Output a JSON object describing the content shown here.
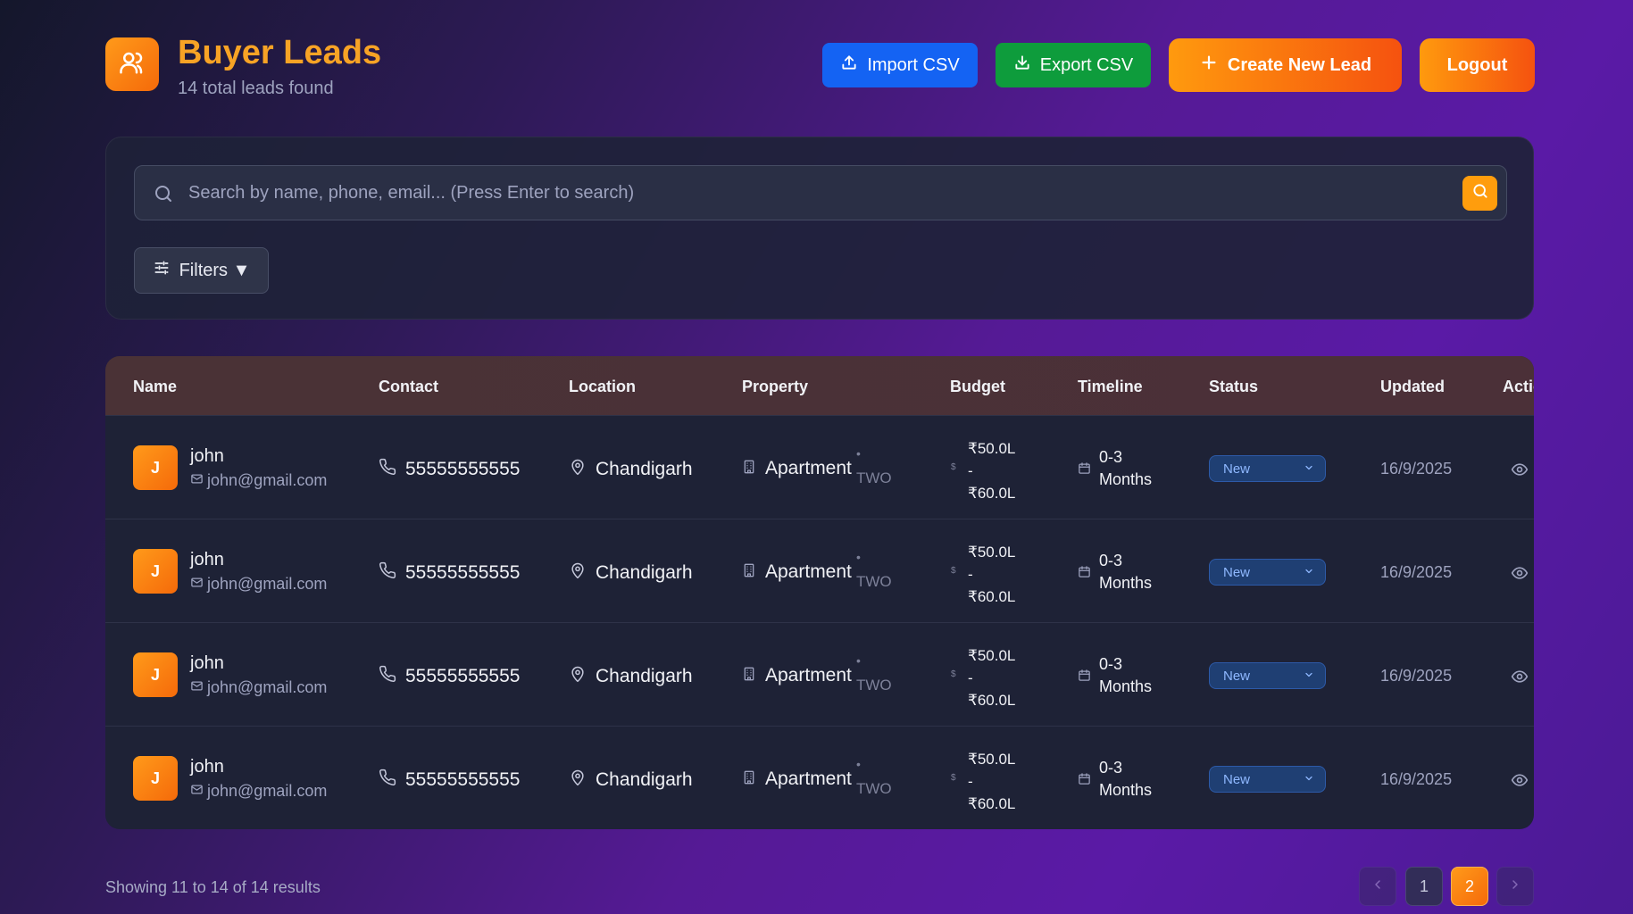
{
  "header": {
    "title": "Buyer Leads",
    "subtitle": "14 total leads found",
    "import_label": "Import CSV",
    "export_label": "Export CSV",
    "create_label": "Create New Lead",
    "logout_label": "Logout"
  },
  "search": {
    "placeholder": "Search by name, phone, email... (Press Enter to search)",
    "value": "",
    "filters_label": "Filters ▼"
  },
  "table": {
    "columns": [
      "Name",
      "Contact",
      "Location",
      "Property",
      "Budget",
      "Timeline",
      "Status",
      "Updated",
      "Actions"
    ],
    "rows": [
      {
        "initial": "J",
        "name": "john",
        "email": "john@gmail.com",
        "phone": "55555555555",
        "city": "Chandigarh",
        "property": "Apartment",
        "dot": "•",
        "bhk": "TWO",
        "currency_icon": "$",
        "budget_min": "₹50.0L",
        "budget_sep": "-",
        "budget_max": "₹60.0L",
        "timeline_1": "0-3",
        "timeline_2": "Months",
        "status": "New",
        "updated": "16/9/2025"
      },
      {
        "initial": "J",
        "name": "john",
        "email": "john@gmail.com",
        "phone": "55555555555",
        "city": "Chandigarh",
        "property": "Apartment",
        "dot": "•",
        "bhk": "TWO",
        "currency_icon": "$",
        "budget_min": "₹50.0L",
        "budget_sep": "-",
        "budget_max": "₹60.0L",
        "timeline_1": "0-3",
        "timeline_2": "Months",
        "status": "New",
        "updated": "16/9/2025"
      },
      {
        "initial": "J",
        "name": "john",
        "email": "john@gmail.com",
        "phone": "55555555555",
        "city": "Chandigarh",
        "property": "Apartment",
        "dot": "•",
        "bhk": "TWO",
        "currency_icon": "$",
        "budget_min": "₹50.0L",
        "budget_sep": "-",
        "budget_max": "₹60.0L",
        "timeline_1": "0-3",
        "timeline_2": "Months",
        "status": "New",
        "updated": "16/9/2025"
      },
      {
        "initial": "J",
        "name": "john",
        "email": "john@gmail.com",
        "phone": "55555555555",
        "city": "Chandigarh",
        "property": "Apartment",
        "dot": "•",
        "bhk": "TWO",
        "currency_icon": "$",
        "budget_min": "₹50.0L",
        "budget_sep": "-",
        "budget_max": "₹60.0L",
        "timeline_1": "0-3",
        "timeline_2": "Months",
        "status": "New",
        "updated": "16/9/2025"
      }
    ]
  },
  "footer": {
    "results_text": "Showing 11 to 14 of 14 results",
    "pages": [
      "1",
      "2"
    ],
    "current_page": "2"
  },
  "colors": {
    "accent": "#ff9a1a",
    "import": "#1463f3",
    "export": "#0e9c3c",
    "status_new": "#8fb8ff"
  },
  "icons": [
    "users-icon",
    "upload-icon",
    "download-icon",
    "plus-icon",
    "search-icon",
    "sliders-icon",
    "phone-icon",
    "map-pin-icon",
    "building-icon",
    "dollar-icon",
    "calendar-icon",
    "chevron-down-icon",
    "eye-icon",
    "chevron-left-icon",
    "chevron-right-icon",
    "mail-icon"
  ]
}
